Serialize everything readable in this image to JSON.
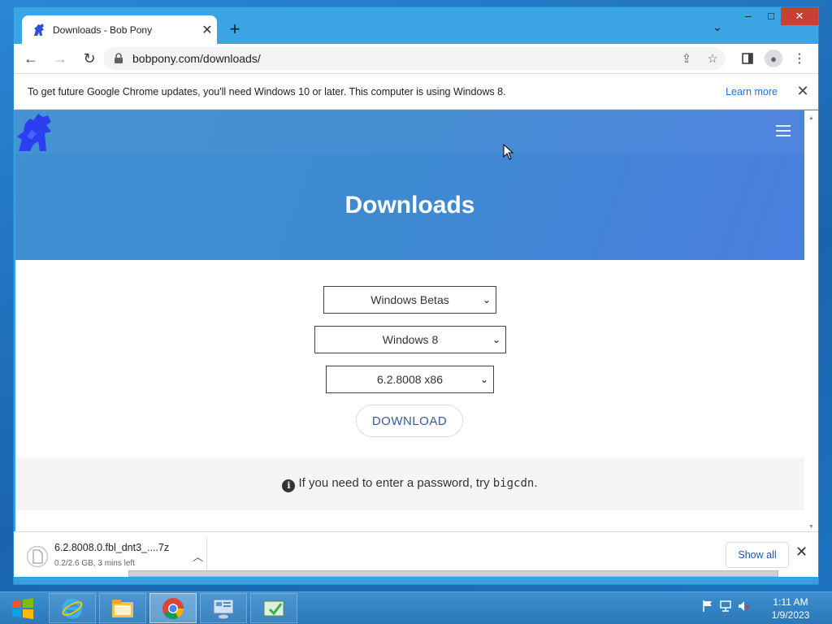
{
  "browser": {
    "tab_title": "Downloads - Bob Pony",
    "new_tab": "+",
    "url": "bobpony.com/downloads/"
  },
  "window_controls": {
    "minimize": "–",
    "maximize": "□",
    "close": "✕"
  },
  "infobar": {
    "message": "To get future Google Chrome updates, you'll need Windows 10 or later. This computer is using Windows 8.",
    "link": "Learn more"
  },
  "page": {
    "hero_title": "Downloads",
    "select_category": "Windows Betas",
    "select_os": "Windows 8",
    "select_build": "6.2.8008 x86",
    "download_button": "DOWNLOAD",
    "note_prefix": "If you need to enter a password, try ",
    "note_code": "bigcdn",
    "note_suffix": "."
  },
  "download_shelf": {
    "file_name": "6.2.8008.0.fbl_dnt3_....7z",
    "status": "0.2/2.6 GB, 3 mins left",
    "show_all": "Show all"
  },
  "taskbar": {
    "time": "1:11 AM",
    "date": "1/9/2023"
  },
  "colors": {
    "hero_start": "#3f8fd2",
    "hero_end": "#4b7fe0",
    "link": "#1a73e8",
    "close_button": "#c84031",
    "download_text": "#3a56a8"
  }
}
